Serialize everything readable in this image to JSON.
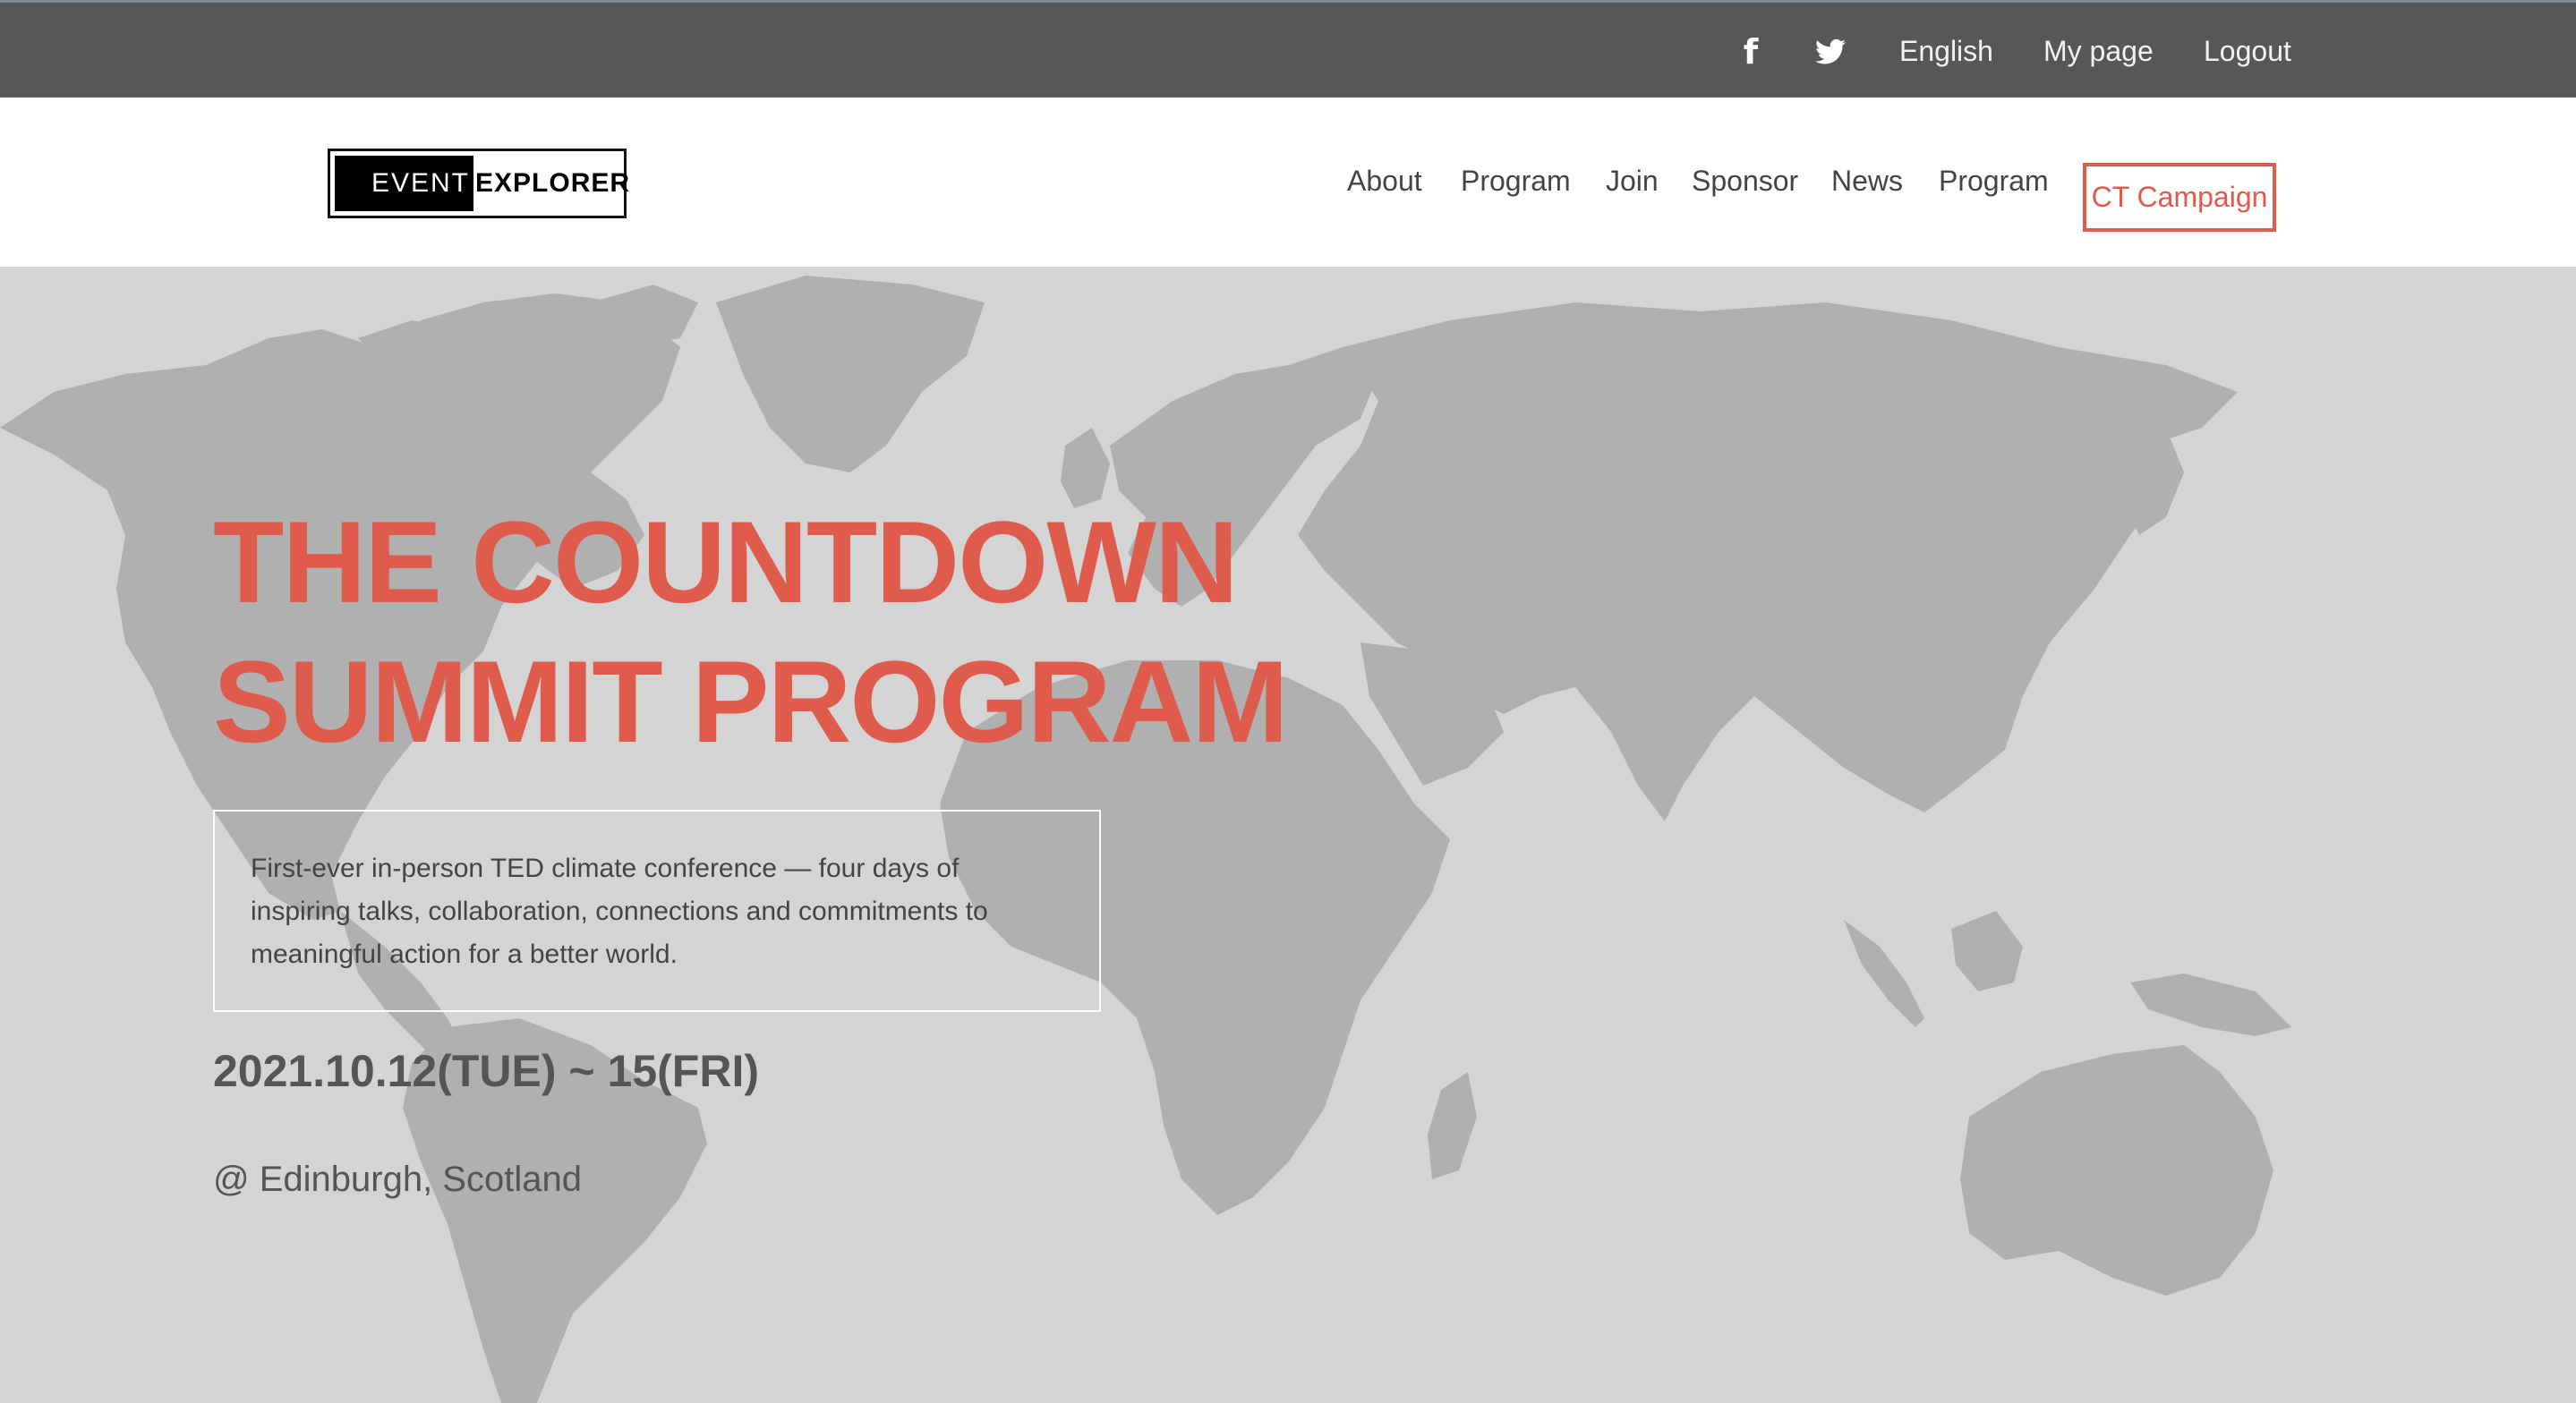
{
  "topbar": {
    "social": [
      {
        "icon": "facebook-icon"
      },
      {
        "icon": "twitter-icon"
      }
    ],
    "language": "English",
    "my_page": "My page",
    "logout": "Logout"
  },
  "header": {
    "logo": {
      "part1": "EVENT",
      "part2": "EXPLORER"
    },
    "nav": [
      "About",
      "Program",
      "Join",
      "Sponsor",
      "News",
      "Program"
    ],
    "cta": "CT Campaign"
  },
  "hero": {
    "title_line1": "THE COUNTDOWN",
    "title_line2": "SUMMIT PROGRAM",
    "description": "First-ever in-person TED climate conference — four days of inspiring talks, collaboration, connections and commitments to meaningful action for a better world.",
    "date": "2021.10.12(TUE) ~ 15(FRI)",
    "location": "@ Edinburgh, Scotland"
  },
  "colors": {
    "topbar_bg": "#575757",
    "accent": "#df5c4d",
    "hero_bg": "#d4d4d4",
    "map": "#b0b0b0"
  }
}
